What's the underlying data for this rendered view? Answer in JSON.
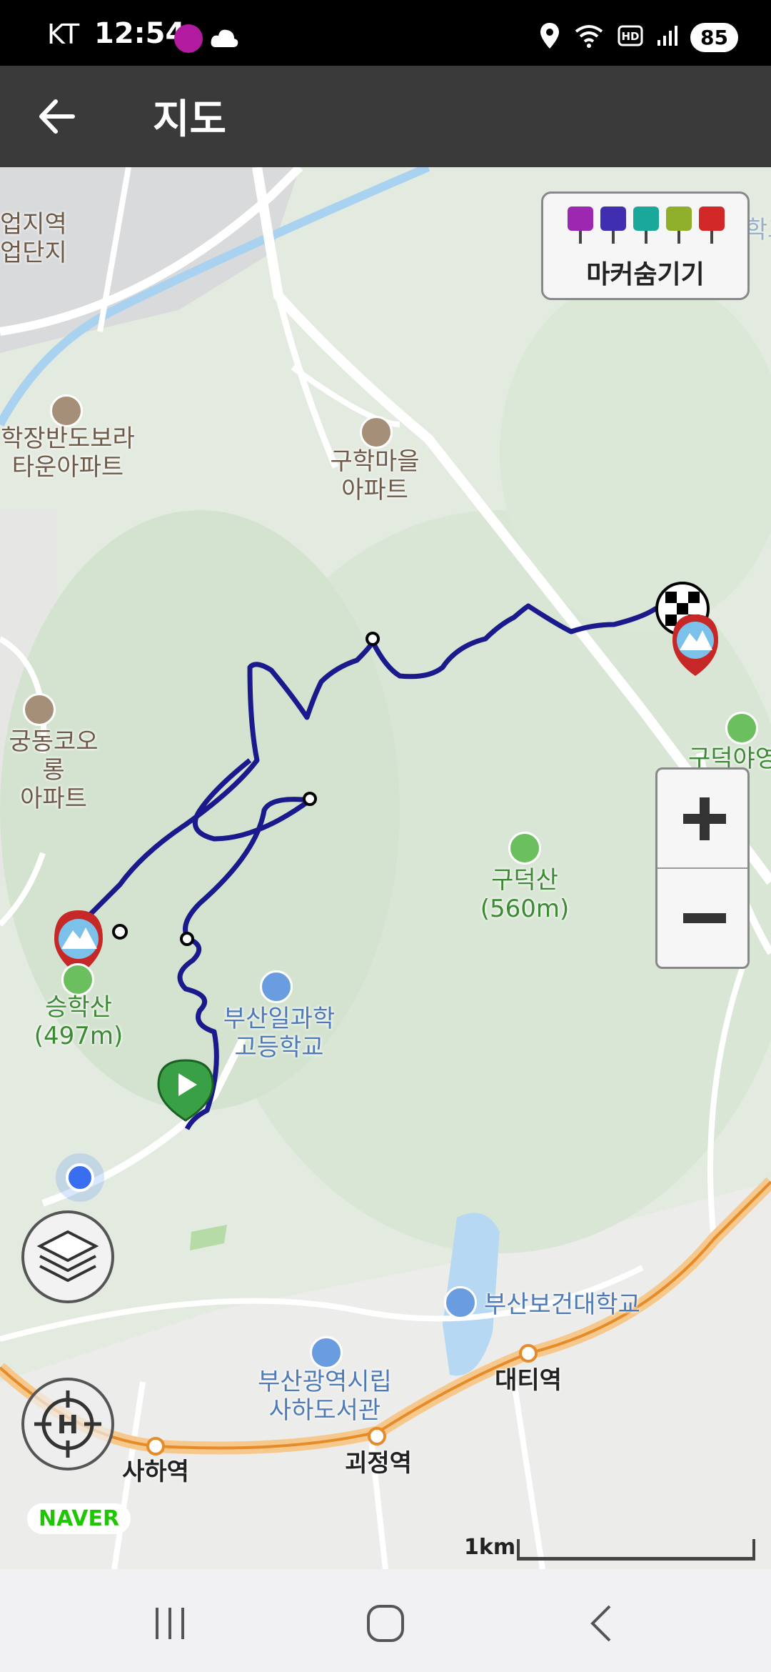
{
  "status_bar": {
    "carrier": "KT",
    "time": "12:54",
    "battery": "85",
    "icons": [
      "busan-app-icon",
      "cloud-icon",
      "location-icon",
      "wifi-icon",
      "hd-icon",
      "signal-icon"
    ]
  },
  "app_bar": {
    "title": "지도",
    "back_icon": "arrow-left-icon"
  },
  "marker_panel": {
    "label": "마커숨기기",
    "markers": [
      {
        "icon": "camera-icon",
        "color": "#9c27b0"
      },
      {
        "icon": "video-icon",
        "color": "#3f2fb0"
      },
      {
        "icon": "mic-icon",
        "color": "#1aa89a"
      },
      {
        "icon": "note-icon",
        "color": "#8fae2a"
      },
      {
        "icon": "pointer-icon",
        "color": "#d22828"
      }
    ]
  },
  "map": {
    "provider": "NAVER",
    "scale_label": "1km",
    "route_color": "#1a1a8c",
    "places": {
      "industrial": "업지역\n업단지",
      "apt_bora": "학장반도보라\n타운아파트",
      "apt_guhak": "구학마을\n아파트",
      "apt_kolon": "궁동코오롱\n아파트",
      "camp": "구덕야영",
      "univ_partial": "부산대학교",
      "mt_gudeok": "구덕산\n(560m)",
      "mt_seunghak": "승학산\n(497m)",
      "school": "부산일과학\n고등학교",
      "health_univ": "부산보건대학교",
      "library": "부산광역시립\n사하도서관",
      "st_daeti": "대티역",
      "st_goejeong": "괴정역",
      "st_saha": "사하역"
    }
  }
}
